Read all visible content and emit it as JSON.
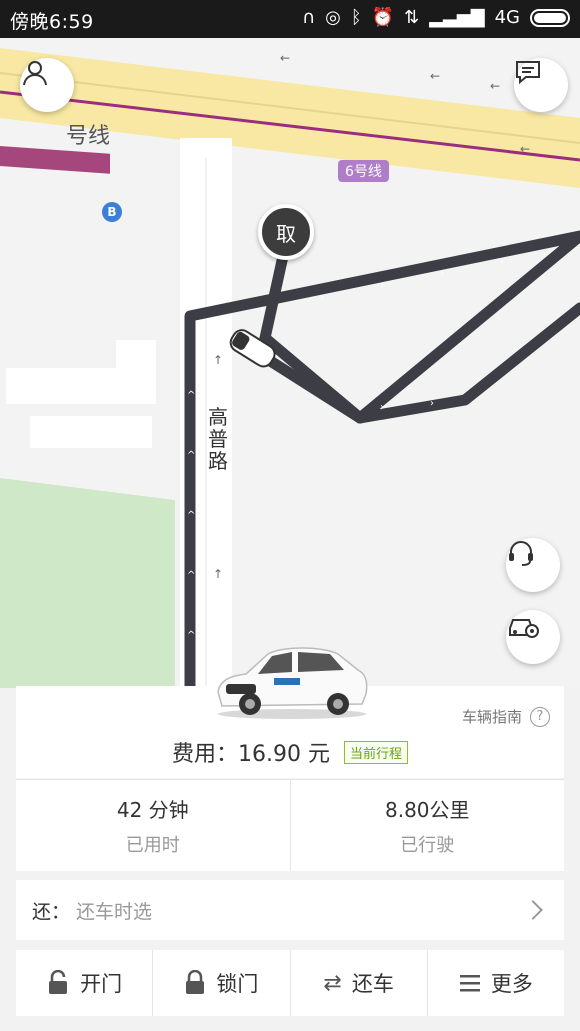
{
  "status_bar": {
    "time": "傍晚6:59",
    "network": "4G"
  },
  "map": {
    "line_label_partial": "号线",
    "line6_label": "6号线",
    "station_badge": "B",
    "road_name": "高普路",
    "pickup_pin_label": "取"
  },
  "trip": {
    "guide_link": "车辆指南",
    "fee": "费用：16.90 元",
    "current_trip_badge": "当前行程",
    "duration_value": "42 分钟",
    "duration_label": "已用时",
    "distance_value": "8.80公里",
    "distance_label": "已行驶"
  },
  "return_row": {
    "label": "还：",
    "value": "还车时选"
  },
  "actions": [
    {
      "label": "开门",
      "icon": "unlock-icon"
    },
    {
      "label": "锁门",
      "icon": "lock-icon"
    },
    {
      "label": "还车",
      "icon": "return-car-icon"
    },
    {
      "label": "更多",
      "icon": "menu-icon"
    }
  ],
  "colors": {
    "accent_green": "#6aa312",
    "route": "#3d3d45",
    "metro_line": "#b07ec9"
  }
}
